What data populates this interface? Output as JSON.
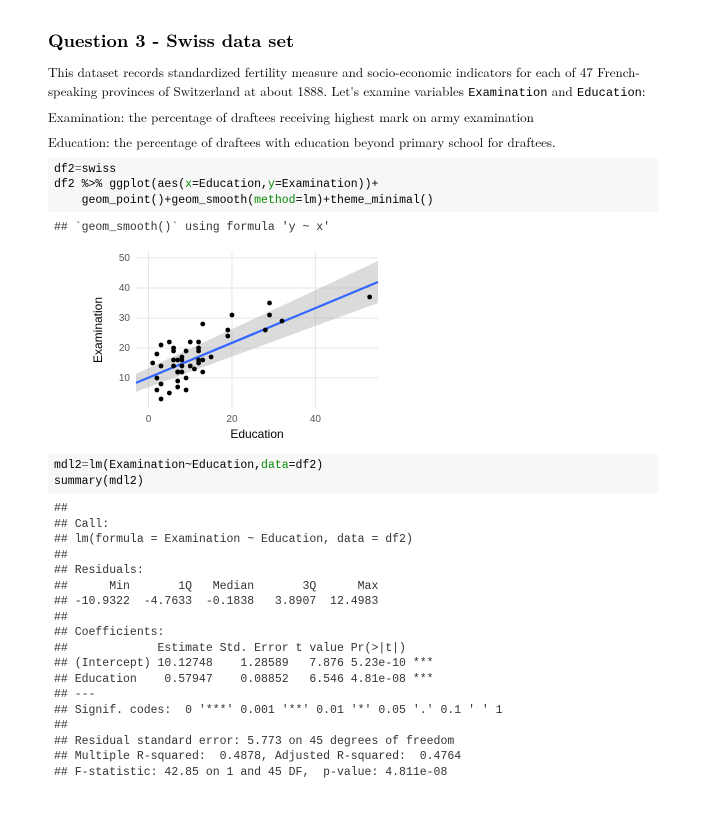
{
  "title": "Question 3 - Swiss data set",
  "intro": "This dataset records standardized fertility measure and socio-economic indicators for each of 47 French-speaking provinces of Switzerland at about 1888. Let's examine variables ",
  "intro_var1": "Examination",
  "intro_mid": " and ",
  "intro_var2": "Education",
  "intro_end": ":",
  "desc_exam": "Examination: the percentage of draftees receiving highest mark on army examination",
  "desc_edu": "Education: the percentage of draftees with education beyond primary school for draftees.",
  "code1": {
    "l1a": "df2",
    "l1b": "=",
    "l1c": "swiss",
    "l2a": "df2 %>% ggplot(aes(",
    "l2b": "x",
    "l2c": "=Education,",
    "l2d": "y",
    "l2e": "=Examination))+",
    "l3a": "    geom_point()+geom_smooth(",
    "l3b": "method",
    "l3c": "=lm)+theme_minimal()"
  },
  "smooth_msg": "## `geom_smooth()` using formula 'y ~ x'",
  "chart_data": {
    "type": "scatter",
    "xlabel": "Education",
    "ylabel": "Examination",
    "xlim": [
      -3,
      55
    ],
    "ylim": [
      0,
      52
    ],
    "xticks": [
      0,
      20,
      40
    ],
    "yticks": [
      10,
      20,
      30,
      40,
      50
    ],
    "regression": {
      "intercept": 10.12748,
      "slope": 0.57947
    },
    "points": [
      [
        12,
        15
      ],
      [
        9,
        6
      ],
      [
        5,
        5
      ],
      [
        7,
        12
      ],
      [
        15,
        17
      ],
      [
        7,
        9
      ],
      [
        7,
        16
      ],
      [
        8,
        14
      ],
      [
        7,
        12
      ],
      [
        13,
        16
      ],
      [
        6,
        14
      ],
      [
        12,
        20
      ],
      [
        7,
        12
      ],
      [
        12,
        19
      ],
      [
        5,
        22
      ],
      [
        2,
        18
      ],
      [
        8,
        17
      ],
      [
        28,
        26
      ],
      [
        20,
        31
      ],
      [
        9,
        19
      ],
      [
        10,
        22
      ],
      [
        3,
        14
      ],
      [
        12,
        22
      ],
      [
        6,
        20
      ],
      [
        1,
        15
      ],
      [
        8,
        16
      ],
      [
        3,
        21
      ],
      [
        10,
        14
      ],
      [
        19,
        24
      ],
      [
        8,
        12
      ],
      [
        2,
        6
      ],
      [
        6,
        16
      ],
      [
        2,
        10
      ],
      [
        6,
        19
      ],
      [
        3,
        8
      ],
      [
        9,
        10
      ],
      [
        3,
        3
      ],
      [
        13,
        12
      ],
      [
        12,
        16
      ],
      [
        11,
        13
      ],
      [
        13,
        28
      ],
      [
        32,
        29
      ],
      [
        7,
        7
      ],
      [
        53,
        37
      ],
      [
        29,
        31
      ],
      [
        29,
        35
      ],
      [
        19,
        26
      ]
    ]
  },
  "code2": {
    "l1a": "mdl2",
    "l1b": "=",
    "l1c": "lm(Examination~Education,",
    "l1d": "data",
    "l1e": "=df2)",
    "l2": "summary(mdl2)"
  },
  "summary_output": "##\n## Call:\n## lm(formula = Examination ~ Education, data = df2)\n##\n## Residuals:\n##      Min       1Q   Median       3Q      Max\n## -10.9322  -4.7633  -0.1838   3.8907  12.4983\n##\n## Coefficients:\n##             Estimate Std. Error t value Pr(>|t|)\n## (Intercept) 10.12748    1.28589   7.876 5.23e-10 ***\n## Education    0.57947    0.08852   6.546 4.81e-08 ***\n## ---\n## Signif. codes:  0 '***' 0.001 '**' 0.01 '*' 0.05 '.' 0.1 ' ' 1\n##\n## Residual standard error: 5.773 on 45 degrees of freedom\n## Multiple R-squared:  0.4878, Adjusted R-squared:  0.4764\n## F-statistic: 42.85 on 1 and 45 DF,  p-value: 4.811e-08"
}
